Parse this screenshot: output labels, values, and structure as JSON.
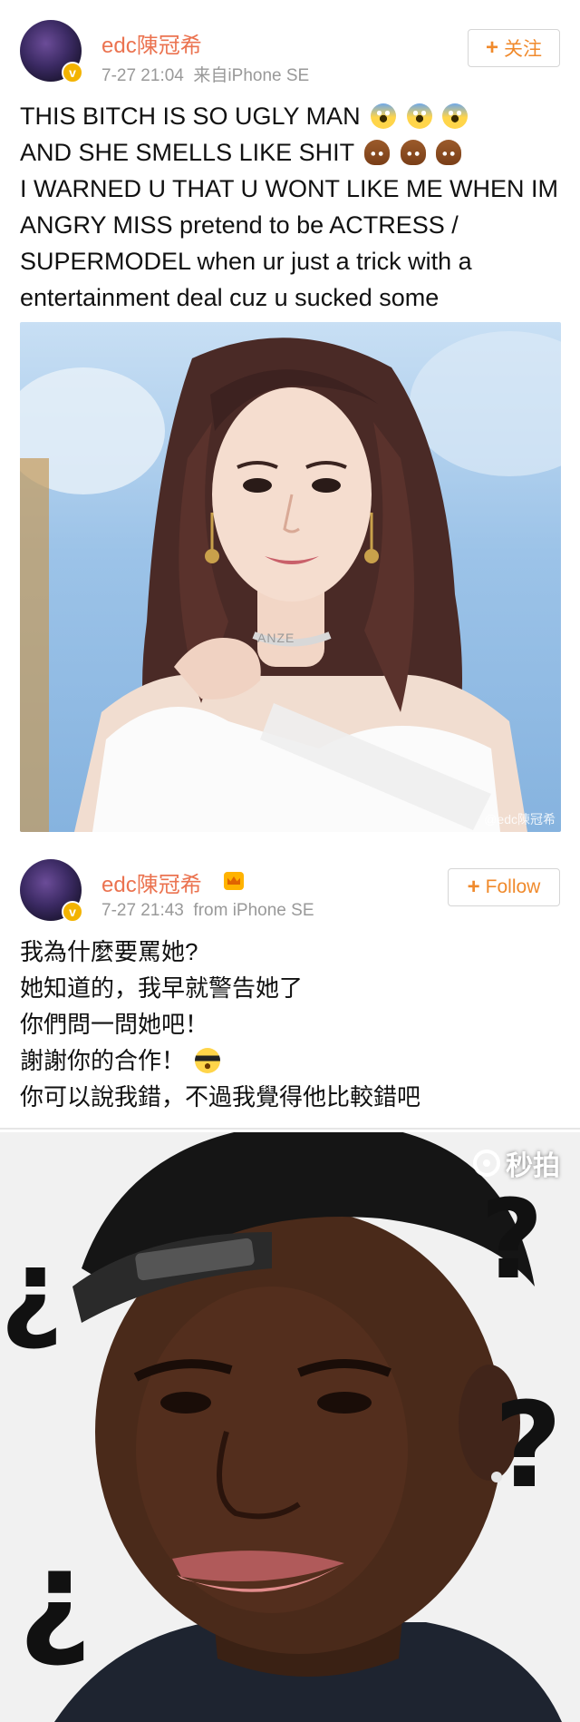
{
  "post1": {
    "username": "edc陳冠希",
    "timestamp": "7-27 21:04",
    "source": "来自iPhone SE",
    "follow_label": "关注",
    "text_lines": [
      "THIS BITCH IS SO UGLY MAN",
      "AND SHE SMELLS LIKE SHIT",
      "I WARNED U THAT U WONT LIKE ME WHEN IM",
      "ANGRY MISS pretend to be ACTRESS /",
      "SUPERMODEL when ur just a trick with a",
      "entertainment deal cuz u sucked some"
    ],
    "emoji_line1": [
      "scream-emoji",
      "scream-emoji",
      "scream-emoji"
    ],
    "emoji_line2": [
      "poo-emoji",
      "poo-emoji",
      "poo-emoji"
    ],
    "photo_sash_text": "ANZE",
    "photo_watermark": "@edc陳冠希"
  },
  "post2": {
    "username": "edc陳冠希",
    "timestamp": "7-27 21:43",
    "source": "from iPhone SE",
    "follow_label": "Follow",
    "text_lines": [
      "我為什麼要罵她?",
      "她知道的，我早就警告她了",
      "你們問一問她吧！",
      "謝謝你的合作！",
      "你可以說我錯，不過我覺得他比較錯吧"
    ],
    "emoji_line4": "sunglasses-emoji"
  },
  "meme": {
    "watermark": "秒拍",
    "question_marks": [
      "¿",
      "?",
      "¿",
      "?"
    ]
  },
  "colors": {
    "username": "#eb7350",
    "follow_text": "#f08a2c",
    "meta": "#999999",
    "verified_badge": "#f3b300"
  }
}
